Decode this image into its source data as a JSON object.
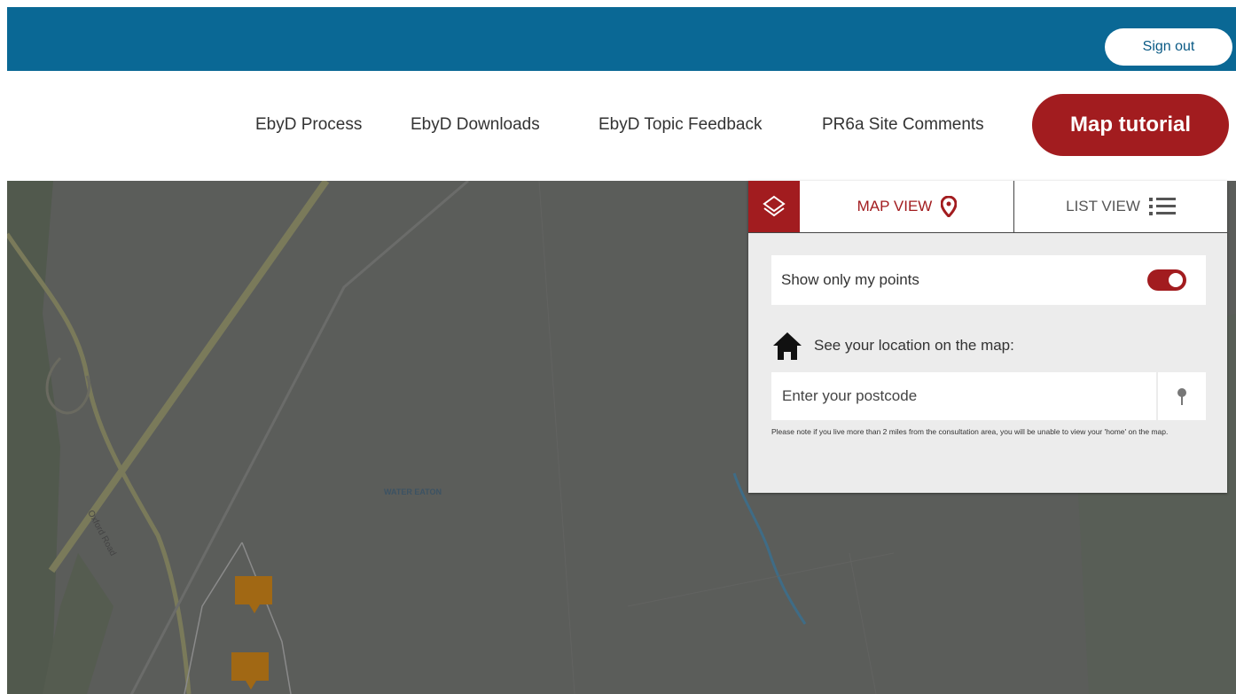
{
  "header": {
    "sign_out_label": "Sign out"
  },
  "nav": {
    "items": [
      {
        "label": "EbyD Process"
      },
      {
        "label": "EbyD Downloads"
      },
      {
        "label": "EbyD Topic Feedback"
      },
      {
        "label": "PR6a Site Comments"
      }
    ],
    "cta_label": "Map tutorial"
  },
  "map": {
    "place_label": "WATER EATON",
    "road_label": "Oxford Road"
  },
  "panel": {
    "map_view_label": "MAP VIEW",
    "list_view_label": "LIST VIEW",
    "toggle_label": "Show only my points",
    "toggle_on": true,
    "location_label": "See your location on the map:",
    "postcode_placeholder": "Enter your postcode",
    "note": "Please note if you live more than 2 miles from the consultation area, you will be unable to view your 'home' on the map."
  },
  "colors": {
    "header_blue": "#0a6895",
    "brand_red": "#a21c1f",
    "marker_orange": "#a16814"
  }
}
